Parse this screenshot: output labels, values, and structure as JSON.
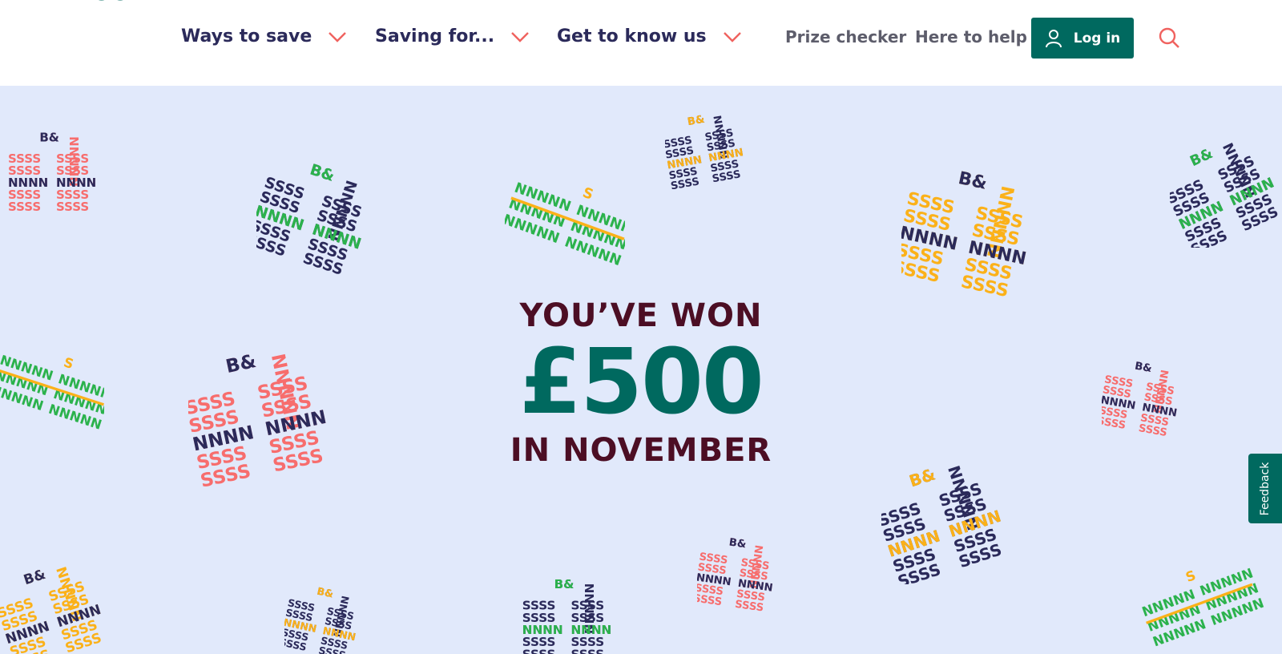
{
  "header": {
    "nav": [
      {
        "label": "Ways to save",
        "icon": "chevron-down-icon"
      },
      {
        "label": "Saving for...",
        "icon": "chevron-down-icon"
      },
      {
        "label": "Get to know us",
        "icon": "chevron-down-icon"
      }
    ],
    "utility_links": [
      {
        "label": "Prize checker"
      },
      {
        "label": "Here to help"
      }
    ],
    "login": {
      "label": "Log in",
      "icon": "user-icon"
    },
    "search": {
      "icon": "search-icon"
    }
  },
  "hero": {
    "line1": "YOU’VE WON",
    "amount": "£500",
    "line3": "IN NOVEMBER",
    "background_color": "#e1e9fb",
    "decoration": "gift-pattern-icon"
  },
  "feedback": {
    "label": "Feedback"
  },
  "colors": {
    "navy": "#2b2a5a",
    "teal": "#00695f",
    "maroon": "#4c0e24",
    "coral": "#f76d6d",
    "orange": "#fbb119",
    "green": "#2bb24c",
    "chevron": "#f0625f"
  }
}
